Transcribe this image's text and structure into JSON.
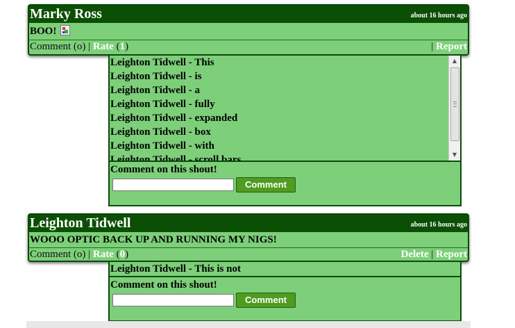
{
  "shouts": [
    {
      "author": "Marky Ross",
      "time": "about 16 hours ago",
      "message": "BOO!",
      "comment_label": "Comment (o) |",
      "rate_label": "Rate",
      "rate_count": "1",
      "right_links": [
        "Report"
      ],
      "comments": [
        "Leighton Tidwell - This",
        "Leighton Tidwell - is",
        "Leighton Tidwell - a",
        "Leighton Tidwell - fully",
        "Leighton Tidwell - expanded",
        "Leighton Tidwell - box",
        "Leighton Tidwell - with",
        "Leighton Tidwell - scroll bars"
      ],
      "comment_prompt": "Comment on this shout!",
      "comment_button": "Comment"
    },
    {
      "author": "Leighton Tidwell",
      "time": "about 16 hours ago",
      "message": "WOOO OPTIC BACK UP AND RUNNING MY NIGS!",
      "comment_label": "Comment (o) |",
      "rate_label": "Rate",
      "rate_count": "0",
      "right_links": [
        "Delete",
        "Report"
      ],
      "comments": [
        "Leighton Tidwell - This is not"
      ],
      "comment_prompt": "Comment on this shout!",
      "comment_button": "Comment"
    }
  ],
  "icons": {
    "broken_image": "broken-image-icon",
    "scroll_up": "scroll-up-arrow",
    "scroll_down": "scroll-down-arrow"
  },
  "colors": {
    "header_bg": "#0b4f05",
    "panel_bg": "#7dcf7a",
    "button_bg": "#4e9c20"
  }
}
